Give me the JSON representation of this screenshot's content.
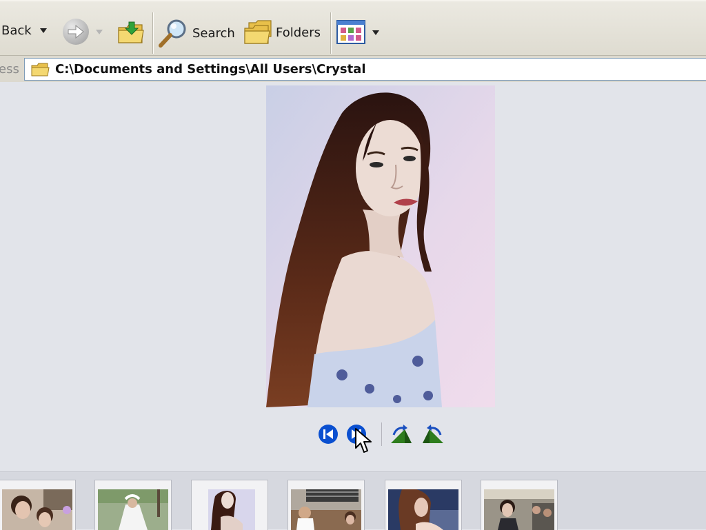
{
  "toolbar": {
    "back_label": "Back",
    "search_label": "Search",
    "folders_label": "Folders",
    "icons": [
      "back-dropdown-icon",
      "forward-arrow-icon",
      "folder-up-icon",
      "search-magnifier-icon",
      "folders-icon",
      "views-icon"
    ]
  },
  "address": {
    "label": "ess",
    "path": "C:\\Documents and Settings\\All Users\\Crystal"
  },
  "viewer": {
    "controls": [
      "previous-image-icon",
      "next-image-icon",
      "rotate-clockwise-icon",
      "rotate-counterclockwise-icon"
    ]
  },
  "filmstrip": {
    "thumbnails": [
      "thumb-1",
      "thumb-2",
      "thumb-3",
      "thumb-4",
      "thumb-5",
      "thumb-6"
    ]
  },
  "colors": {
    "toolbar_bg": "#e6e3da",
    "viewer_bg": "#e2e4ea",
    "nav_button_blue": "#0a4fd0",
    "rotate_green": "#2e7d1e"
  }
}
